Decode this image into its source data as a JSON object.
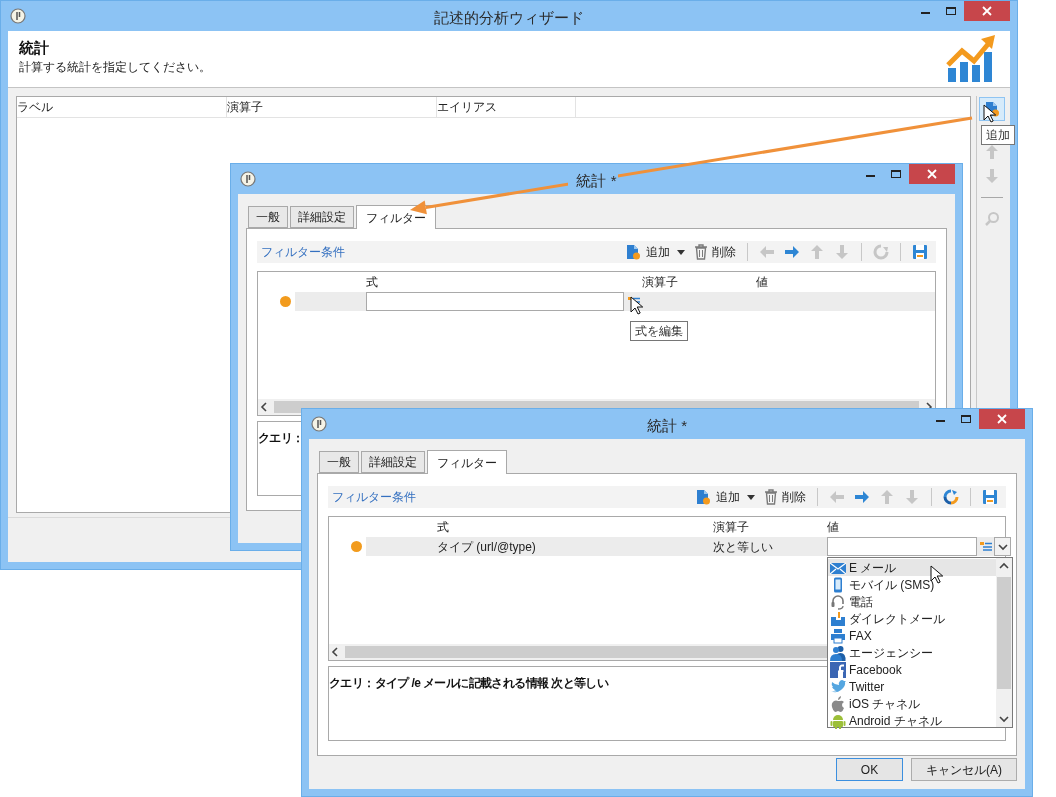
{
  "wizard": {
    "title": "記述的分析ウィザード",
    "heading": "統計",
    "subtitle": "計算する統計を指定してください。",
    "columns": [
      "ラベル",
      "演算子",
      "エイリアス"
    ],
    "tools": [
      {
        "kind": "add",
        "disabled": false,
        "highlighted": true
      },
      {
        "kind": "up",
        "disabled": true,
        "highlighted": false
      },
      {
        "kind": "down",
        "disabled": true,
        "highlighted": false
      },
      {
        "kind": "search",
        "disabled": true,
        "highlighted": false
      }
    ],
    "tooltip": "追加"
  },
  "dialog_back": {
    "title": "統計 *",
    "tabs": [
      {
        "label": "一般",
        "selected": false
      },
      {
        "label": "詳細設定",
        "selected": false
      },
      {
        "label": "フィルター",
        "selected": true
      }
    ],
    "toolbar": {
      "link": "フィルター条件",
      "add": "追加",
      "delete": "削除",
      "tools": [
        {
          "kind": "left",
          "disabled": true
        },
        {
          "kind": "right",
          "disabled": false
        },
        {
          "kind": "up",
          "disabled": true
        },
        {
          "kind": "down",
          "disabled": true
        },
        {
          "kind": "refresh",
          "disabled": true
        },
        {
          "kind": "save",
          "disabled": false
        }
      ]
    },
    "columns": [
      "式",
      "演算子",
      "値"
    ],
    "rows": [
      {
        "kind": "editing-expression",
        "color": "#f29b1d"
      }
    ],
    "tooltip": "式を編集",
    "query": "クエリ："
  },
  "dialog_front": {
    "title": "統計 *",
    "tabs": [
      {
        "label": "一般",
        "selected": false
      },
      {
        "label": "詳細設定",
        "selected": false
      },
      {
        "label": "フィルター",
        "selected": true
      }
    ],
    "toolbar": {
      "link": "フィルター条件",
      "add": "追加",
      "delete": "削除",
      "tools": [
        {
          "kind": "left",
          "disabled": true
        },
        {
          "kind": "right",
          "disabled": false
        },
        {
          "kind": "up",
          "disabled": true
        },
        {
          "kind": "down",
          "disabled": true
        },
        {
          "kind": "refresh",
          "disabled": false
        },
        {
          "kind": "save",
          "disabled": false
        }
      ]
    },
    "columns": [
      "式",
      "演算子",
      "値"
    ],
    "rows": [
      {
        "kind": "editing-value",
        "color": "#f29b1d",
        "expression": "タイプ (url/@type)",
        "operator": "次と等しい"
      }
    ],
    "dropdown": {
      "expanded": true,
      "items": [
        {
          "kind": "mail",
          "label": "E メール",
          "selected": true
        },
        {
          "kind": "mobile",
          "label": "モバイル (SMS)",
          "selected": false
        },
        {
          "kind": "phone",
          "label": "電話",
          "selected": false
        },
        {
          "kind": "direct-mail",
          "label": "ダイレクトメール",
          "selected": false
        },
        {
          "kind": "fax",
          "label": "FAX",
          "selected": false
        },
        {
          "kind": "agency",
          "label": "エージェンシー",
          "selected": false
        },
        {
          "kind": "facebook",
          "label": "Facebook",
          "selected": false
        },
        {
          "kind": "twitter",
          "label": "Twitter",
          "selected": false
        },
        {
          "kind": "ios",
          "label": "iOS チャネル",
          "selected": false
        },
        {
          "kind": "android",
          "label": "Android チャネル",
          "selected": false
        }
      ]
    },
    "query": "クエリ：タイプ /e メールに記載される情報 次と等しい",
    "buttons": [
      {
        "label": "OK",
        "default": true
      },
      {
        "label": "キャンセル(A)",
        "default": false
      }
    ]
  }
}
